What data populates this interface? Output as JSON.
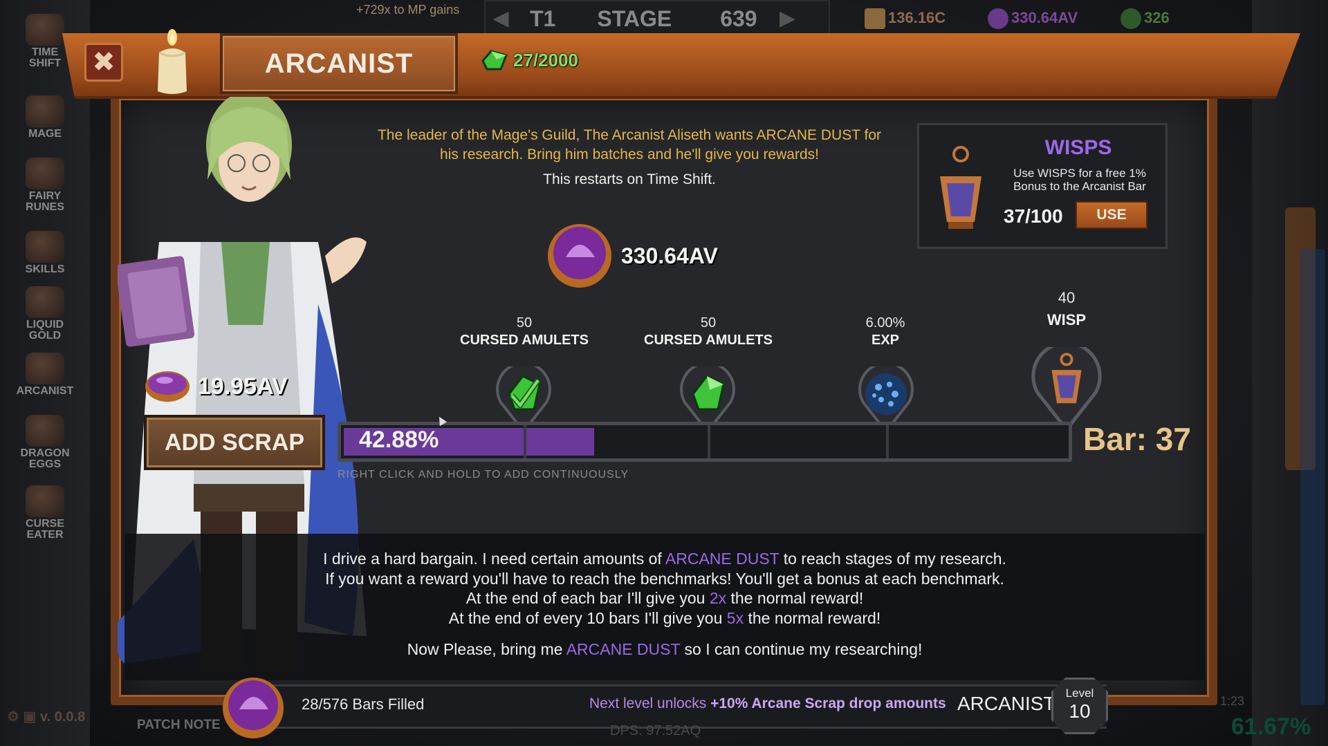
{
  "background": {
    "mp_gains": "+729x to MP gains",
    "stage": {
      "tier": "T1",
      "label": "STAGE",
      "number": "639"
    },
    "resources": {
      "coins": "136.16C",
      "dust": "330.64AV",
      "gems": "326"
    },
    "sidebar": [
      {
        "label": "TIME SHIFT"
      },
      {
        "label": "MAGE"
      },
      {
        "label": "FAIRY RUNES"
      },
      {
        "label": "SKILLS"
      },
      {
        "label": "LIQUID GOLD"
      },
      {
        "label": "ARCANIST"
      },
      {
        "label": "DRAGON EGGS"
      },
      {
        "label": "CURSE EATER"
      }
    ],
    "version": "v. 0.0.8",
    "patch_notes": "PATCH NOTE",
    "dps": "DPS: 97.52AQ",
    "timer": "1:23",
    "percent": "61.67%"
  },
  "modal": {
    "title": "ARCANIST",
    "gem_counter": "27/2000",
    "description": "The leader of the Mage's Guild, The Arcanist Aliseth wants ARCANE DUST for his research. Bring him batches and he'll give you rewards!",
    "restart_note": "This restarts on Time Shift.",
    "dust_total": "330.64AV",
    "player_dust": "19.95AV",
    "add_scrap_label": "ADD SCRAP",
    "wisps": {
      "title": "WISPS",
      "description": "Use WISPS for a free 1% Bonus to the Arcanist Bar",
      "count": "37/100",
      "use_label": "USE"
    },
    "rewards": [
      {
        "amount": "50",
        "name": "CURSED AMULETS",
        "icon": "cursed-amulet-check-icon"
      },
      {
        "amount": "50",
        "name": "CURSED AMULETS",
        "icon": "cursed-amulet-icon"
      },
      {
        "amount": "6.00%",
        "name": "EXP",
        "icon": "exp-orb-icon"
      },
      {
        "amount": "40",
        "name": "WISP",
        "icon": "wisp-lantern-icon"
      }
    ],
    "progress": {
      "percent_label": "42.88%",
      "fraction": 0.3472,
      "bar_label": "Bar: 37"
    },
    "hint": "RIGHT CLICK AND HOLD TO ADD CONTINUOUSLY",
    "dialogue": {
      "line1_a": "I drive a hard bargain. I need certain amounts of ",
      "line1_hl": "ARCANE DUST",
      "line1_b": " to reach stages of my research.",
      "line2": "If you want a reward you'll have to reach the benchmarks! You'll get a bonus at each benchmark.",
      "line3_a": "At the end of each bar I'll give you ",
      "line3_hl": "2x",
      "line3_b": " the normal reward!",
      "line4_a": "At the end of every 10 bars I'll give you ",
      "line4_hl": "5x",
      "line4_b": " the normal reward!",
      "line5_a": "Now Please, bring me ",
      "line5_hl": "ARCANE DUST",
      "line5_b": " so I can continue my researching!"
    },
    "footer": {
      "bars_filled": "28/576 Bars Filled",
      "next_level_prefix": "Next level unlocks ",
      "next_level_bold": "+10% Arcane Scrap drop amounts",
      "name": "ARCANIST",
      "level_label": "Level",
      "level_value": "10"
    }
  },
  "colors": {
    "accent_purple": "#9a6ae8",
    "header_orange": "#c46a28",
    "gold_text": "#e6b848",
    "green_gem": "#7ee06a"
  }
}
